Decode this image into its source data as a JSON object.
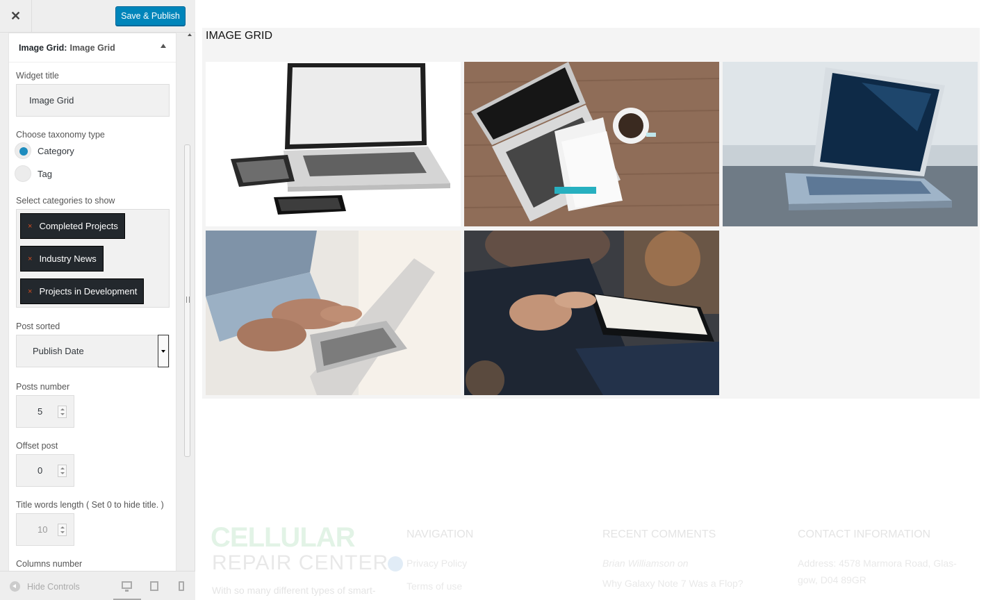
{
  "header": {
    "close_label": "✕",
    "save_label": "Save & Publish"
  },
  "widget": {
    "title_prefix": "Image Grid:",
    "title_name": "Image Grid",
    "fields": {
      "widget_title_label": "Widget title",
      "widget_title_value": "Image Grid",
      "taxonomy_label": "Choose taxonomy type",
      "taxonomy_options": [
        "Category",
        "Tag"
      ],
      "taxonomy_selected": "Category",
      "categories_label": "Select categories to show",
      "categories": [
        "Completed Projects",
        "Industry News",
        "Projects in Development"
      ],
      "remove_glyph": "×",
      "post_sorted_label": "Post sorted",
      "post_sorted_value": "Publish Date",
      "posts_number_label": "Posts number",
      "posts_number_value": "5",
      "offset_label": "Offset post",
      "offset_value": "0",
      "title_words_label": "Title words length ( Set 0 to hide title. )",
      "title_words_value": "10",
      "columns_label": "Columns number"
    }
  },
  "footer_controls": {
    "hide_controls_label": "Hide Controls",
    "devices": [
      "desktop-icon",
      "tablet-icon",
      "mobile-icon"
    ]
  },
  "preview": {
    "grid_title": "IMAGE GRID",
    "images": [
      {
        "name": "laptop-tablet-phone-white",
        "colors": [
          "#ffffff",
          "#d9d9d9",
          "#2b2b2b"
        ]
      },
      {
        "name": "laptop-notepad-coffee-wood",
        "colors": [
          "#8c6a55",
          "#cfcfcf",
          "#222222"
        ]
      },
      {
        "name": "laptop-blue-screen-table",
        "colors": [
          "#c9d1d6",
          "#0d2a4a",
          "#9aa7b2"
        ]
      },
      {
        "name": "hands-typing-laptop",
        "colors": [
          "#e9e6e1",
          "#a07a62",
          "#7d8fa0"
        ]
      },
      {
        "name": "man-reading-book",
        "colors": [
          "#2c2f38",
          "#b88a6e",
          "#1a2230"
        ]
      }
    ]
  },
  "site_footer": {
    "logo_line1": "CELLULAR",
    "logo_line2": "REPAIR CENTER",
    "description": "With so many different types of smart-",
    "navigation_heading": "NAVIGATION",
    "navigation_items": [
      "Privacy Policy",
      "Terms of use"
    ],
    "comments_heading": "RECENT COMMENTS",
    "comment_author": "Brian Williamson",
    "comment_on": "on",
    "comment_post": "Why Galaxy Note 7 Was a Flop?",
    "contact_heading": "CONTACT INFORMATION",
    "contact_line1": "Address: 4578 Marmora Road, Glas-",
    "contact_line2": "gow, D04 89GR"
  },
  "colors": {
    "accent": "#0085ba",
    "tag_bg": "#23282d",
    "remove_x": "#d54e21",
    "radio_on": "#1e8cbe",
    "logo_green": "#2ba84a"
  }
}
